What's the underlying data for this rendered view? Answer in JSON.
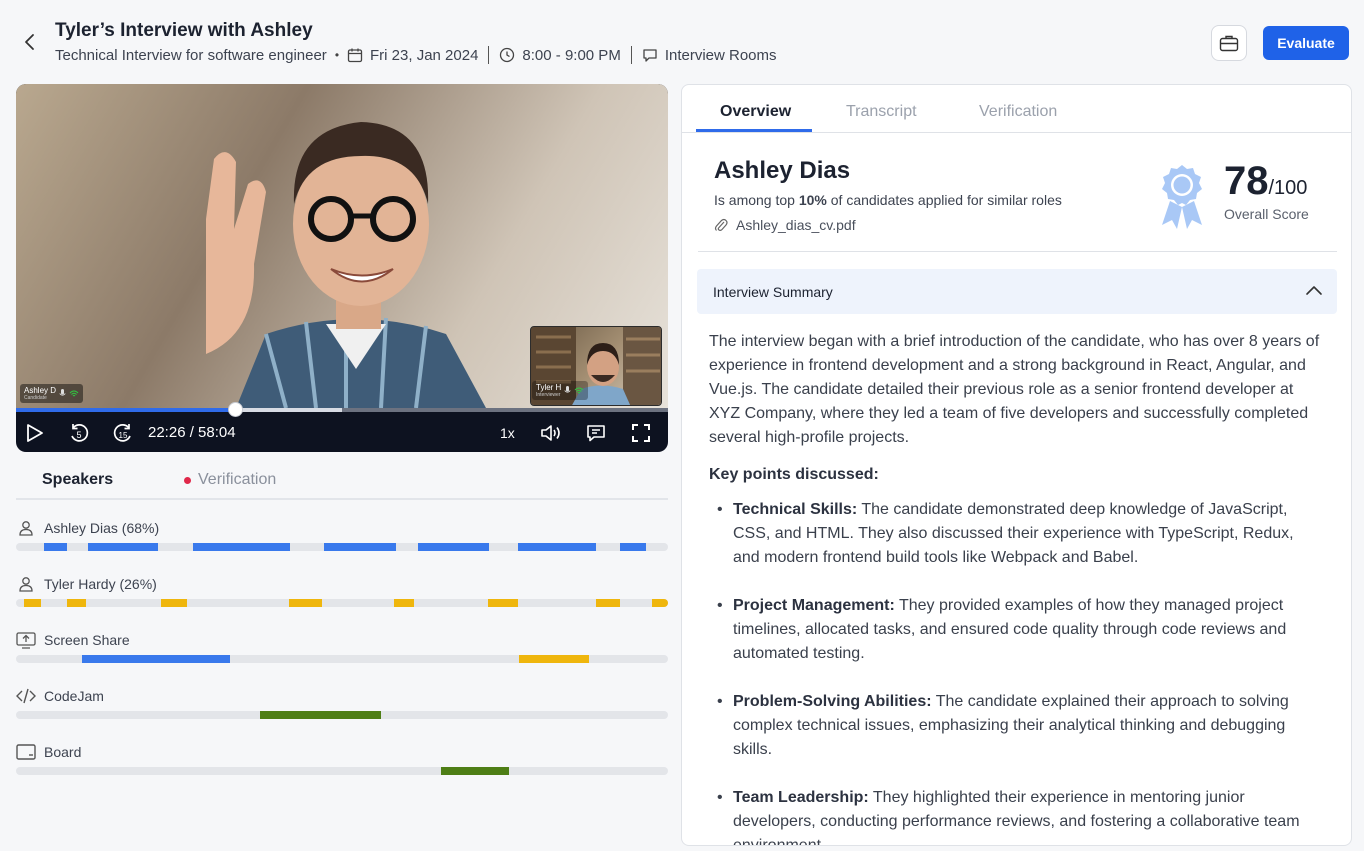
{
  "header": {
    "title": "Tyler’s Interview with Ashley",
    "subtitle": "Technical Interview for software engineer",
    "date": "Fri 23, Jan 2024",
    "time": "8:00 - 9:00 PM",
    "location": "Interview Rooms",
    "evaluate_label": "Evaluate"
  },
  "video": {
    "candidate_tag": "Ashley D",
    "candidate_role": "Candidate",
    "interviewer_tag": "Tyler H",
    "interviewer_role": "Interviewer",
    "time_display": "22:26 / 58:04",
    "speed": "1x",
    "played_fraction": 0.337,
    "buffered_fraction": 0.5
  },
  "speakers": {
    "tab_speakers": "Speakers",
    "tab_verification": "Verification",
    "tracks": [
      {
        "label": "Ashley Dias (68%)",
        "icon": "user-icon",
        "color": "blue",
        "segments": [
          [
            0.043,
            0.078
          ],
          [
            0.11,
            0.218
          ],
          [
            0.271,
            0.42
          ],
          [
            0.473,
            0.583
          ],
          [
            0.616,
            0.726
          ],
          [
            0.77,
            0.89
          ],
          [
            0.927,
            0.967
          ]
        ]
      },
      {
        "label": "Tyler Hardy (26%)",
        "icon": "user-icon",
        "color": "yellow",
        "segments": [
          [
            0.012,
            0.038
          ],
          [
            0.078,
            0.107
          ],
          [
            0.223,
            0.263
          ],
          [
            0.419,
            0.469
          ],
          [
            0.58,
            0.61
          ],
          [
            0.724,
            0.77
          ],
          [
            0.89,
            0.926
          ],
          [
            0.975,
            1.0
          ]
        ]
      },
      {
        "label": "Screen Share",
        "icon": "screen-share-icon",
        "color": "mixed",
        "segments": [
          [
            0.101,
            0.329,
            "blue"
          ],
          [
            0.771,
            0.879,
            "yellow"
          ]
        ]
      },
      {
        "label": "CodeJam",
        "icon": "code-icon",
        "color": "green",
        "segments": [
          [
            0.374,
            0.56
          ]
        ]
      },
      {
        "label": "Board",
        "icon": "board-icon",
        "color": "green",
        "segments": [
          [
            0.652,
            0.756
          ]
        ]
      }
    ]
  },
  "panel": {
    "tabs": [
      "Overview",
      "Transcript",
      "Verification"
    ],
    "candidate_name": "Ashley Dias",
    "rank_prefix": "Is among top ",
    "rank_value": "10%",
    "rank_suffix": " of candidates applied for similar roles",
    "cv_file": "Ashley_dias_cv.pdf",
    "score": "78",
    "score_outof": "/100",
    "score_label": "Overall Score",
    "summary_title": "Interview Summary",
    "summary_text": "The interview began with a brief introduction of the candidate, who has over 8 years of experience in frontend development and a strong background in React, Angular, and Vue.js. The candidate detailed their previous role as a senior frontend developer at XYZ Company, where they led a team of five developers and successfully completed several high-profile projects.",
    "key_points_title": "Key points discussed:",
    "key_points": [
      {
        "title": "Technical Skills:",
        "text": " The candidate demonstrated deep knowledge of JavaScript, CSS, and HTML. They also discussed their experience with TypeScript, Redux, and modern frontend build tools like Webpack and Babel."
      },
      {
        "title": "Project Management:",
        "text": " They provided examples of how they managed project timelines, allocated tasks, and ensured code quality through code reviews and automated testing."
      },
      {
        "title": "Problem-Solving Abilities:",
        "text": " The candidate explained their approach to solving complex technical issues, emphasizing their analytical thinking and debugging skills."
      },
      {
        "title": "Team Leadership:",
        "text": " They highlighted their experience in mentoring junior developers, conducting performance reviews, and fostering a collaborative team environment."
      }
    ]
  },
  "colors": {
    "accent": "#1f62e8",
    "speaker_blue": "#3979ec",
    "speaker_yellow": "#efb60d",
    "tool_green": "#4e7e16",
    "alert_red": "#e0284a"
  }
}
